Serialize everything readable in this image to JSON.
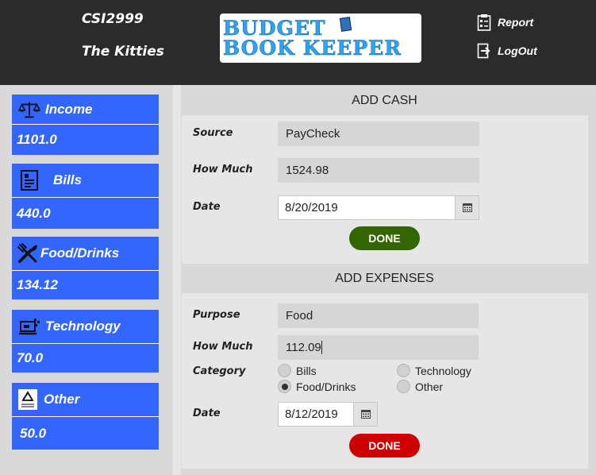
{
  "header": {
    "course": "CSI2999",
    "team": "The Kitties",
    "logo_line1": "BUDGET",
    "logo_line2": "BOOK KEEPER",
    "report_label": "Report",
    "logout_label": "LogOut"
  },
  "categories": [
    {
      "label": "Income",
      "value": "1101.0",
      "icon": "scales-icon"
    },
    {
      "label": "Bills",
      "value": "440.0",
      "icon": "bill-icon"
    },
    {
      "label": "Food/Drinks",
      "value": "134.12",
      "icon": "utensils-icon"
    },
    {
      "label": "Technology",
      "value": "70.0",
      "icon": "computer-icon"
    },
    {
      "label": "Other",
      "value": "50.0",
      "icon": "recycle-icon"
    }
  ],
  "add_cash": {
    "title": "ADD CASH",
    "source_label": "Source",
    "source_value": "PayCheck",
    "amount_label": "How Much",
    "amount_value": "1524.98",
    "date_label": "Date",
    "date_value": "8/20/2019",
    "done_label": "DONE",
    "done_color": "#336600"
  },
  "add_expenses": {
    "title": "ADD EXPENSES",
    "purpose_label": "Purpose",
    "purpose_value": "Food",
    "amount_label": "How Much",
    "amount_value": "112.09",
    "category_label": "Category",
    "options": [
      "Bills",
      "Technology",
      "Food/Drinks",
      "Other"
    ],
    "selected": "Food/Drinks",
    "date_label": "Date",
    "date_value": "8/12/2019",
    "done_label": "DONE",
    "done_color": "#cc0000"
  },
  "colors": {
    "header_bg": "#2b2b2b",
    "card_blue": "#3366ff",
    "panel_bg": "#d9d9d9",
    "form_bg": "#e6e6e6"
  }
}
